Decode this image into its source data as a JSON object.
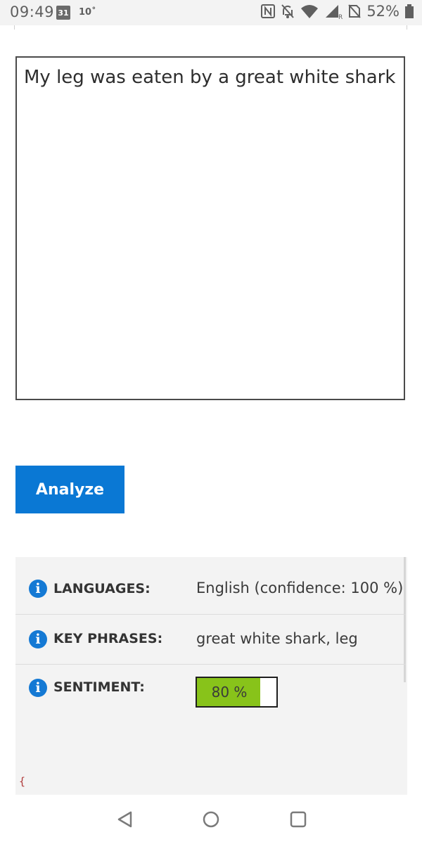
{
  "status_bar": {
    "time": "09:49",
    "calendar_day": "31",
    "temperature": "10˚",
    "battery_percent": "52%"
  },
  "editor": {
    "text": "My leg was eaten by a great white shark"
  },
  "actions": {
    "analyze_label": "Analyze"
  },
  "results": {
    "languages": {
      "label": "LANGUAGES:",
      "value": "English (confidence: 100 %)"
    },
    "key_phrases": {
      "label": "KEY PHRASES:",
      "value": "great white shark, leg"
    },
    "sentiment": {
      "label": "SENTIMENT:",
      "value_text": "80 %",
      "value_fraction": 0.8
    },
    "info_glyph": "i",
    "json_brace": "{"
  },
  "colors": {
    "accent_blue": "#0a78d4",
    "sentiment_green": "#88c31a",
    "panel_bg": "#f3f3f3"
  },
  "icons": {
    "status": [
      "calendar-icon",
      "nfc-icon",
      "bell-off-icon",
      "wifi-icon",
      "signal-icon",
      "no-sim-icon",
      "battery-icon"
    ],
    "nav": [
      "back-icon",
      "home-icon",
      "recents-icon"
    ]
  }
}
